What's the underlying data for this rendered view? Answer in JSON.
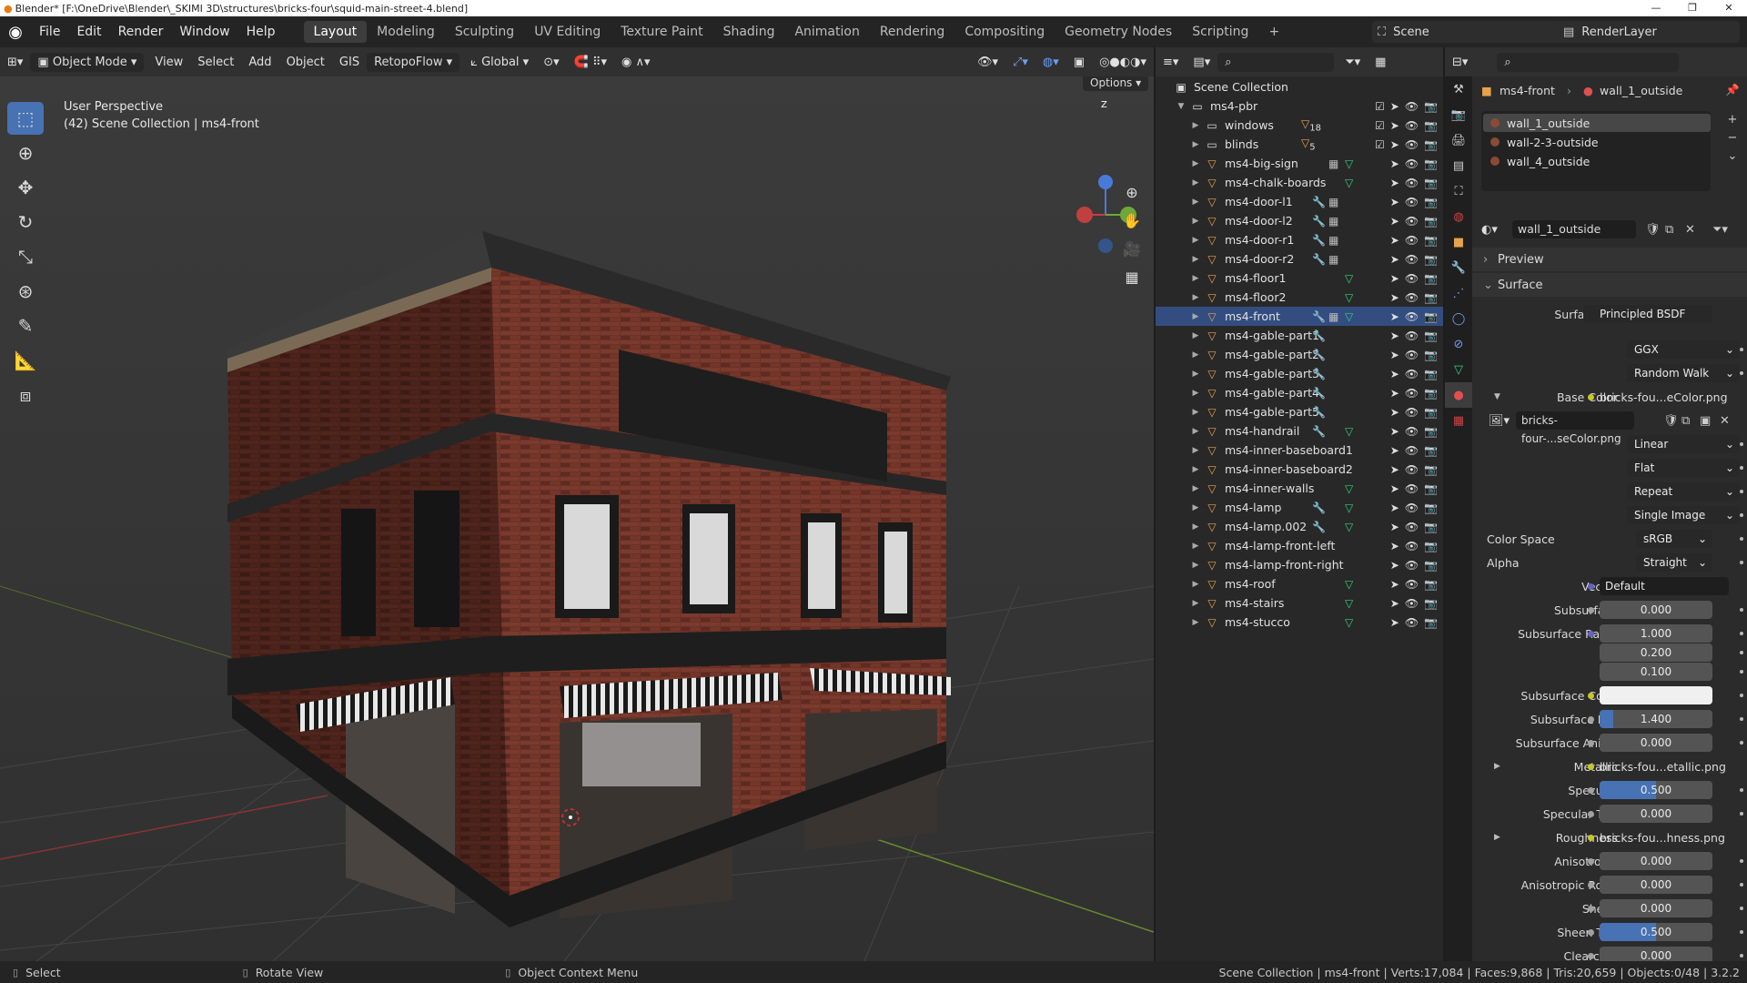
{
  "title_bar": {
    "text": "Blender* [F:\\OneDrive\\Blender\\_SKIMI 3D\\structures\\bricks-four\\squid-main-street-4.blend]",
    "controls": [
      "—",
      "❐",
      "✕"
    ]
  },
  "menu": [
    "File",
    "Edit",
    "Render",
    "Window",
    "Help"
  ],
  "workspaces": [
    "Layout",
    "Modeling",
    "Sculpting",
    "UV Editing",
    "Texture Paint",
    "Shading",
    "Animation",
    "Rendering",
    "Compositing",
    "Geometry Nodes",
    "Scripting"
  ],
  "active_workspace": "Layout",
  "scene_name": "Scene",
  "view_layer": "RenderLayer",
  "viewport_header": {
    "mode": "Object Mode",
    "menus": [
      "View",
      "Select",
      "Add",
      "Object",
      "GIS"
    ],
    "addon": "RetopoFlow",
    "orientation": "Global",
    "options_label": "Options"
  },
  "viewport": {
    "perspective": "User Perspective",
    "collection_info": "(42) Scene Collection | ms4-front",
    "gizmo_z": "Z"
  },
  "tools": [
    "select-box",
    "cursor",
    "move",
    "rotate",
    "scale",
    "transform",
    "annotate",
    "measure",
    "add-cube"
  ],
  "outliner": {
    "root": "Scene Collection",
    "collection": "ms4-pbr",
    "items": [
      {
        "name": "windows",
        "type": "collection",
        "count": "18",
        "checked": true
      },
      {
        "name": "blinds",
        "type": "collection",
        "count": "5",
        "checked": true
      },
      {
        "name": "ms4-big-sign",
        "mod": false,
        "grid": true,
        "mesh": true
      },
      {
        "name": "ms4-chalk-boards",
        "mod": false,
        "mesh": true
      },
      {
        "name": "ms4-door-l1",
        "mod": true,
        "grid": true
      },
      {
        "name": "ms4-door-l2",
        "mod": true,
        "grid": true
      },
      {
        "name": "ms4-door-r1",
        "mod": true,
        "grid": true
      },
      {
        "name": "ms4-door-r2",
        "mod": true,
        "grid": true
      },
      {
        "name": "ms4-floor1",
        "mesh": true
      },
      {
        "name": "ms4-floor2",
        "mesh": true
      },
      {
        "name": "ms4-front",
        "mod": true,
        "grid": true,
        "mesh": true,
        "selected": true
      },
      {
        "name": "ms4-gable-part1",
        "mod": true
      },
      {
        "name": "ms4-gable-part2",
        "mod": true
      },
      {
        "name": "ms4-gable-part3",
        "mod": true
      },
      {
        "name": "ms4-gable-part4",
        "mod": true
      },
      {
        "name": "ms4-gable-part5",
        "mod": true
      },
      {
        "name": "ms4-handrail",
        "mod": true,
        "mesh": true
      },
      {
        "name": "ms4-inner-baseboard1"
      },
      {
        "name": "ms4-inner-baseboard2"
      },
      {
        "name": "ms4-inner-walls",
        "mesh": true
      },
      {
        "name": "ms4-lamp",
        "mod": true,
        "mesh": true
      },
      {
        "name": "ms4-lamp.002",
        "mod": true,
        "mesh": true
      },
      {
        "name": "ms4-lamp-front-left"
      },
      {
        "name": "ms4-lamp-front-right"
      },
      {
        "name": "ms4-roof",
        "mesh": true
      },
      {
        "name": "ms4-stairs",
        "mesh": true
      },
      {
        "name": "ms4-stucco",
        "mesh": true
      }
    ]
  },
  "properties": {
    "breadcrumb_object": "ms4-front",
    "breadcrumb_material": "wall_1_outside",
    "material_slots": [
      "wall_1_outside",
      "wall-2-3-outside",
      "wall_4_outside"
    ],
    "material_name": "wall_1_outside",
    "panels": {
      "preview": "Preview",
      "surface": "Surface"
    },
    "surface_shader": "Principled BSDF",
    "distribution": "GGX",
    "subsurface_method": "Random Walk",
    "base_color_label": "Base Color",
    "base_color_tex": "bricks-fou...eColor.png",
    "image_name": "bricks-four-...seColor.png",
    "interpolation": "Linear",
    "projection": "Flat",
    "extension": "Repeat",
    "source": "Single Image",
    "color_space_label": "Color Space",
    "color_space": "sRGB",
    "alpha_label": "Alpha",
    "alpha": "Straight",
    "vector_label": "Vector",
    "vector": "Default",
    "fields": [
      {
        "label": "Subsurface",
        "value": "0.000"
      },
      {
        "label": "Subsurface Rad...",
        "value": "1.000"
      },
      {
        "label": "",
        "value": "0.200"
      },
      {
        "label": "",
        "value": "0.100"
      },
      {
        "label": "Subsurface Color",
        "value": ""
      },
      {
        "label": "Subsurface IOR",
        "value": "1.400"
      },
      {
        "label": "Subsurface Anis...",
        "value": "0.000"
      },
      {
        "label": "Metallic",
        "value": "bricks-fou...etallic.png"
      },
      {
        "label": "Specular",
        "value": "0.500"
      },
      {
        "label": "Specular Tint",
        "value": "0.000"
      },
      {
        "label": "Roughness",
        "value": "bricks-fou...hness.png"
      },
      {
        "label": "Anisotropic",
        "value": "0.000"
      },
      {
        "label": "Anisotropic Rot...",
        "value": "0.000"
      },
      {
        "label": "Sheen",
        "value": "0.000"
      },
      {
        "label": "Sheen Tint",
        "value": "0.500"
      },
      {
        "label": "Clearcoat",
        "value": "0.000"
      }
    ]
  },
  "statusbar": {
    "select": "Select",
    "rotate": "Rotate View",
    "context": "Object Context Menu",
    "stats": "Scene Collection | ms4-front | Verts:17,084 | Faces:9,868 | Tris:20,659 | Objects:0/48 | 3.2.2"
  },
  "colors": {
    "accent": "#4772b3",
    "selected_row": "#334d80",
    "brick": "#6e3428"
  }
}
